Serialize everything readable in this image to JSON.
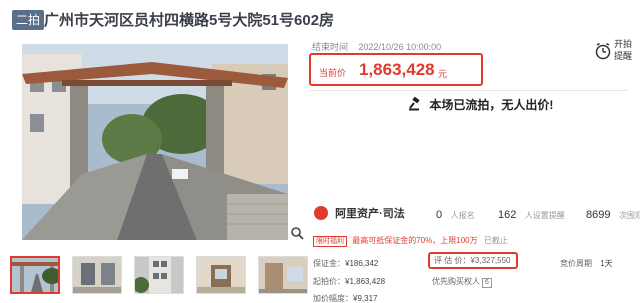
{
  "header": {
    "tag": "二拍",
    "title": "广州市天河区员村四横路5号大院51号602房"
  },
  "auction": {
    "end_time_label": "结束时间",
    "end_time": "2022/10/26 10:00:00",
    "current_price_label": "当前价",
    "current_price": "1,863,428",
    "currency_unit": "元",
    "reminder_label": "开拍提醒",
    "status": "本场已流拍，无人出价!"
  },
  "platform": {
    "name": "阿里资产·司法"
  },
  "stats": [
    {
      "value": "0",
      "label": "人报名"
    },
    {
      "value": "162",
      "label": "人设置提醒"
    },
    {
      "value": "8699",
      "label": "次围观"
    }
  ],
  "promo": {
    "badge": "限时福利",
    "text": "最高可抵保证金的70%，上限100万",
    "status": "已截止"
  },
  "details": {
    "deposit_label": "保证金：",
    "deposit": "¥186,342",
    "start_price_label": "起拍价：",
    "start_price": "¥1,863,428",
    "increment_label": "加价幅度：",
    "increment": "¥9,317",
    "eval_label": "评 估 价：",
    "eval_price": "¥3,327,550",
    "priority_label": "优先购买权人",
    "priority_tag": "6",
    "cycle_label": "竞价周期",
    "cycle": "1天"
  },
  "icons": {
    "zoom": "search-icon",
    "reminder": "alarm-clock-icon",
    "failed": "gavel-icon"
  },
  "colors": {
    "accent": "#e23a2f",
    "tag_bg": "#5a6f8a"
  }
}
